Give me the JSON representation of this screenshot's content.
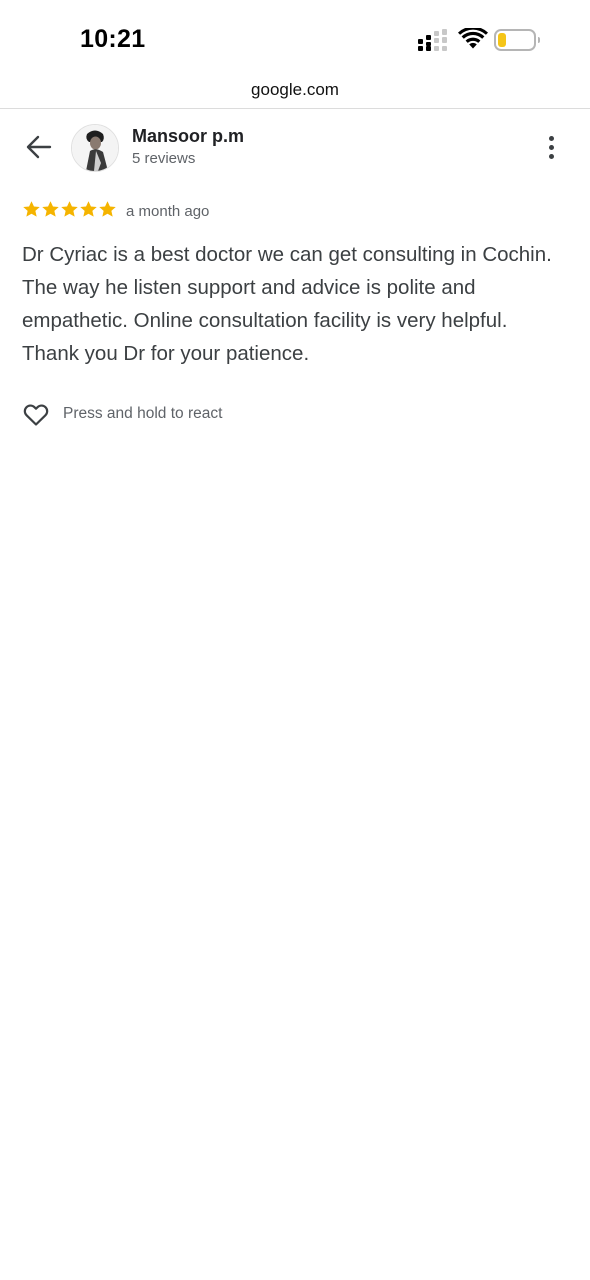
{
  "status_bar": {
    "time": "10:21",
    "icons": [
      "signal-icon",
      "wifi-icon",
      "battery-icon"
    ]
  },
  "browser": {
    "url": "google.com"
  },
  "reviewer": {
    "name": "Mansoor p.m",
    "reviews_count": "5 reviews"
  },
  "review": {
    "rating": 5,
    "max_rating": 5,
    "time": "a month ago",
    "text": "Dr Cyriac is a best doctor we can get consulting in Cochin. The way he listen support and advice is polite and empathetic. Online consultation facility is very helpful. Thank you Dr for your patience."
  },
  "actions": {
    "react_label": "Press and hold to react"
  },
  "colors": {
    "star": "#F5B400",
    "battery_fill": "#F5C518",
    "text_primary": "#202124",
    "text_secondary": "#5f6368"
  }
}
